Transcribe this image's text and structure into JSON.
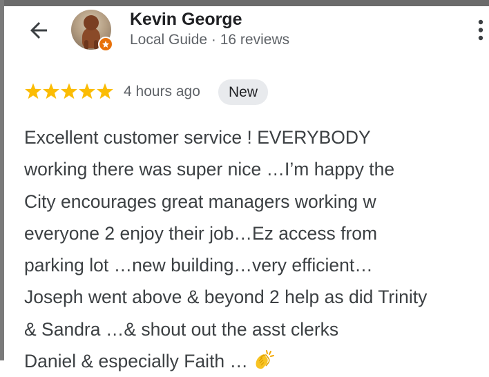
{
  "reviewer": {
    "name": "Kevin George",
    "meta": "Local Guide · 16 reviews"
  },
  "review": {
    "rating": 5,
    "rating_max": 5,
    "time": "4 hours ago",
    "badge": "New",
    "text": "Excellent customer service ! EVERYBODY\nworking there was super nice …I’m happy the\nCity encourages great managers working w\neveryone 2 enjoy their job…Ez access from\nparking lot …new building…very efficient…\nJoseph went above & beyond 2 help as did Trinity\n& Sandra …& shout out the asst clerks\nDaniel & especially Faith …"
  },
  "icons": {
    "back": "arrow-back-icon",
    "more": "more-vert-icon",
    "star": "star-icon",
    "local_guide": "local-guide-badge-icon",
    "emoji": "clapping-hands-emoji"
  },
  "colors": {
    "star": "#fbbc04",
    "badge": "#e8710a",
    "chip_bg": "#e8eaed",
    "name": "#202124",
    "secondary": "#5f6368",
    "body": "#3c4043"
  }
}
